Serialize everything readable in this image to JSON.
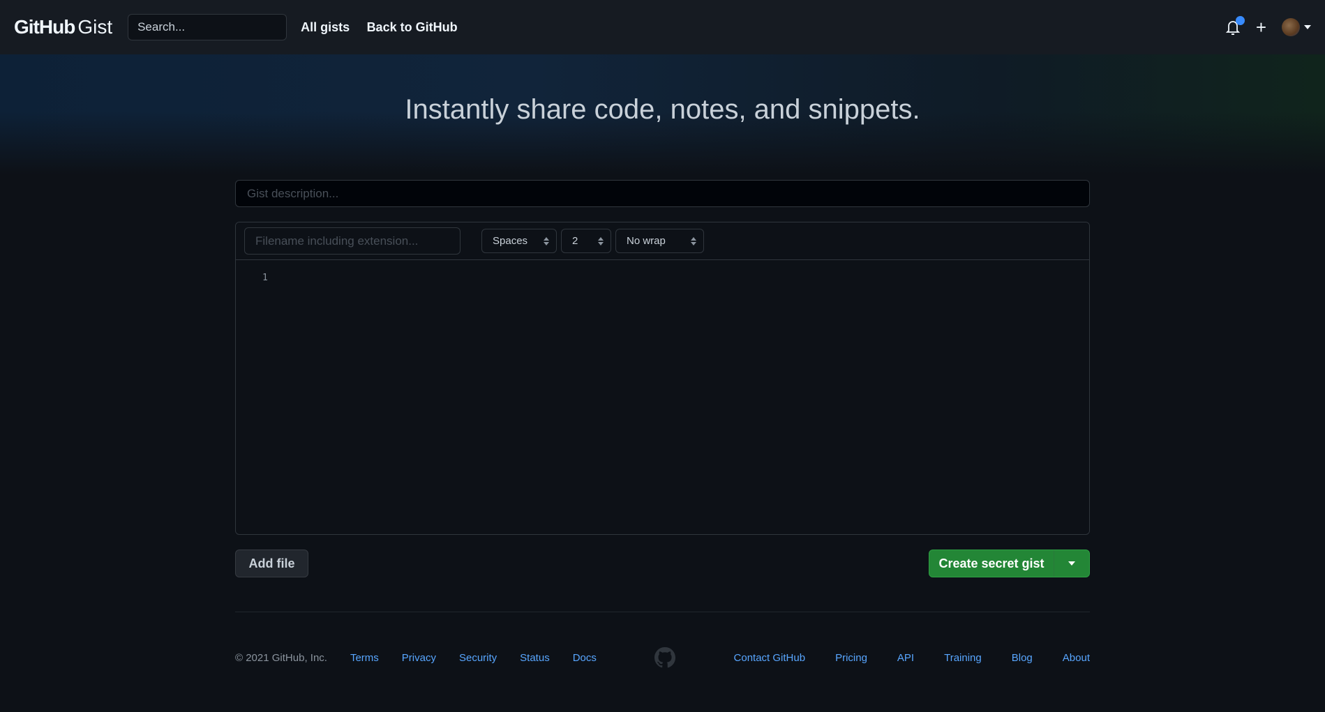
{
  "header": {
    "logo_bold": "GitHub",
    "logo_light": "Gist",
    "search_placeholder": "Search...",
    "nav": [
      "All gists",
      "Back to GitHub"
    ],
    "notification_color": "#388bfd"
  },
  "hero": {
    "title": "Instantly share code, notes, and snippets."
  },
  "form": {
    "description_placeholder": "Gist description...",
    "filename_placeholder": "Filename including extension...",
    "indent_mode": "Spaces",
    "indent_size": "2",
    "wrap_mode": "No wrap",
    "line_numbers": [
      "1"
    ],
    "add_file": "Add file",
    "create": "Create secret gist",
    "accent": "#238636"
  },
  "footer": {
    "copyright": "© 2021 GitHub, Inc.",
    "left_links": [
      "Terms",
      "Privacy",
      "Security",
      "Status",
      "Docs"
    ],
    "right_links": [
      "Contact GitHub",
      "Pricing",
      "API",
      "Training",
      "Blog",
      "About"
    ]
  }
}
